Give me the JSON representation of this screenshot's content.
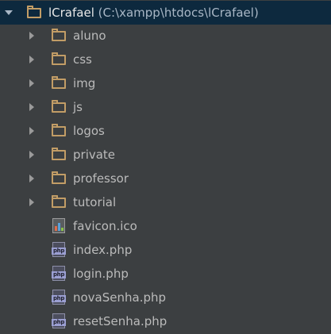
{
  "project": {
    "name": "lCrafael",
    "path": "(C:\\xampp\\htdocs\\lCrafael)"
  },
  "folders": [
    {
      "label": "aluno"
    },
    {
      "label": "css"
    },
    {
      "label": "img"
    },
    {
      "label": "js"
    },
    {
      "label": "logos"
    },
    {
      "label": "private"
    },
    {
      "label": "professor"
    },
    {
      "label": "tutorial"
    }
  ],
  "files": [
    {
      "label": "favicon.ico",
      "icon": "ico-file-icon"
    },
    {
      "label": "index.php",
      "icon": "php-file-icon",
      "badge": "php"
    },
    {
      "label": "login.php",
      "icon": "php-file-icon",
      "badge": "php"
    },
    {
      "label": "novaSenha.php",
      "icon": "php-file-icon",
      "badge": "php"
    },
    {
      "label": "resetSenha.php",
      "icon": "php-file-icon",
      "badge": "php"
    }
  ],
  "colors": {
    "background": "#3c3f41",
    "selection": "#0d293e",
    "folder": "#c29d66",
    "text": "#bbbbbb",
    "php_badge": "#9b9fd2"
  }
}
